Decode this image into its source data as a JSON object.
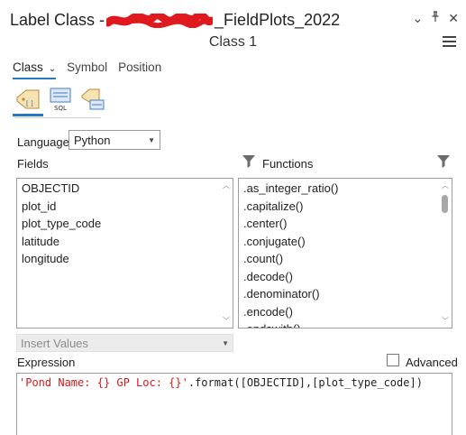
{
  "header": {
    "title_prefix": "Label Class - ",
    "title_suffix": "_FieldPlots_2022",
    "subtitle": "Class 1",
    "controls": {
      "menu_chevron": "⌄",
      "pin": "ᵖ",
      "close": "✕"
    }
  },
  "tabs": [
    {
      "label": "Class",
      "active": true
    },
    {
      "label": "Symbol",
      "active": false
    },
    {
      "label": "Position",
      "active": false
    }
  ],
  "toolbar": {
    "icons": [
      "label-expression-icon",
      "sql-query-icon",
      "label-placement-icon"
    ],
    "sql_text": "SQL"
  },
  "language": {
    "label": "Language",
    "value": "Python"
  },
  "fields": {
    "label": "Fields",
    "items": [
      "OBJECTID",
      "plot_id",
      "plot_type_code",
      "latitude",
      "longitude"
    ]
  },
  "functions": {
    "label": "Functions",
    "items": [
      ".as_integer_ratio()",
      ".capitalize()",
      ".center()",
      ".conjugate()",
      ".count()",
      ".decode()",
      ".denominator()",
      ".encode()",
      ".endswith()"
    ]
  },
  "insert_values": {
    "label": "Insert Values"
  },
  "expression": {
    "label": "Expression",
    "advanced_label": "Advanced",
    "string_part": "'Pond Name: {} GP Loc: {}'",
    "rest_part": ".format([OBJECTID],[plot_type_code])"
  },
  "colors": {
    "accent": "#2479c5",
    "string_red": "#d11b1b",
    "redaction": "#e0191f"
  }
}
